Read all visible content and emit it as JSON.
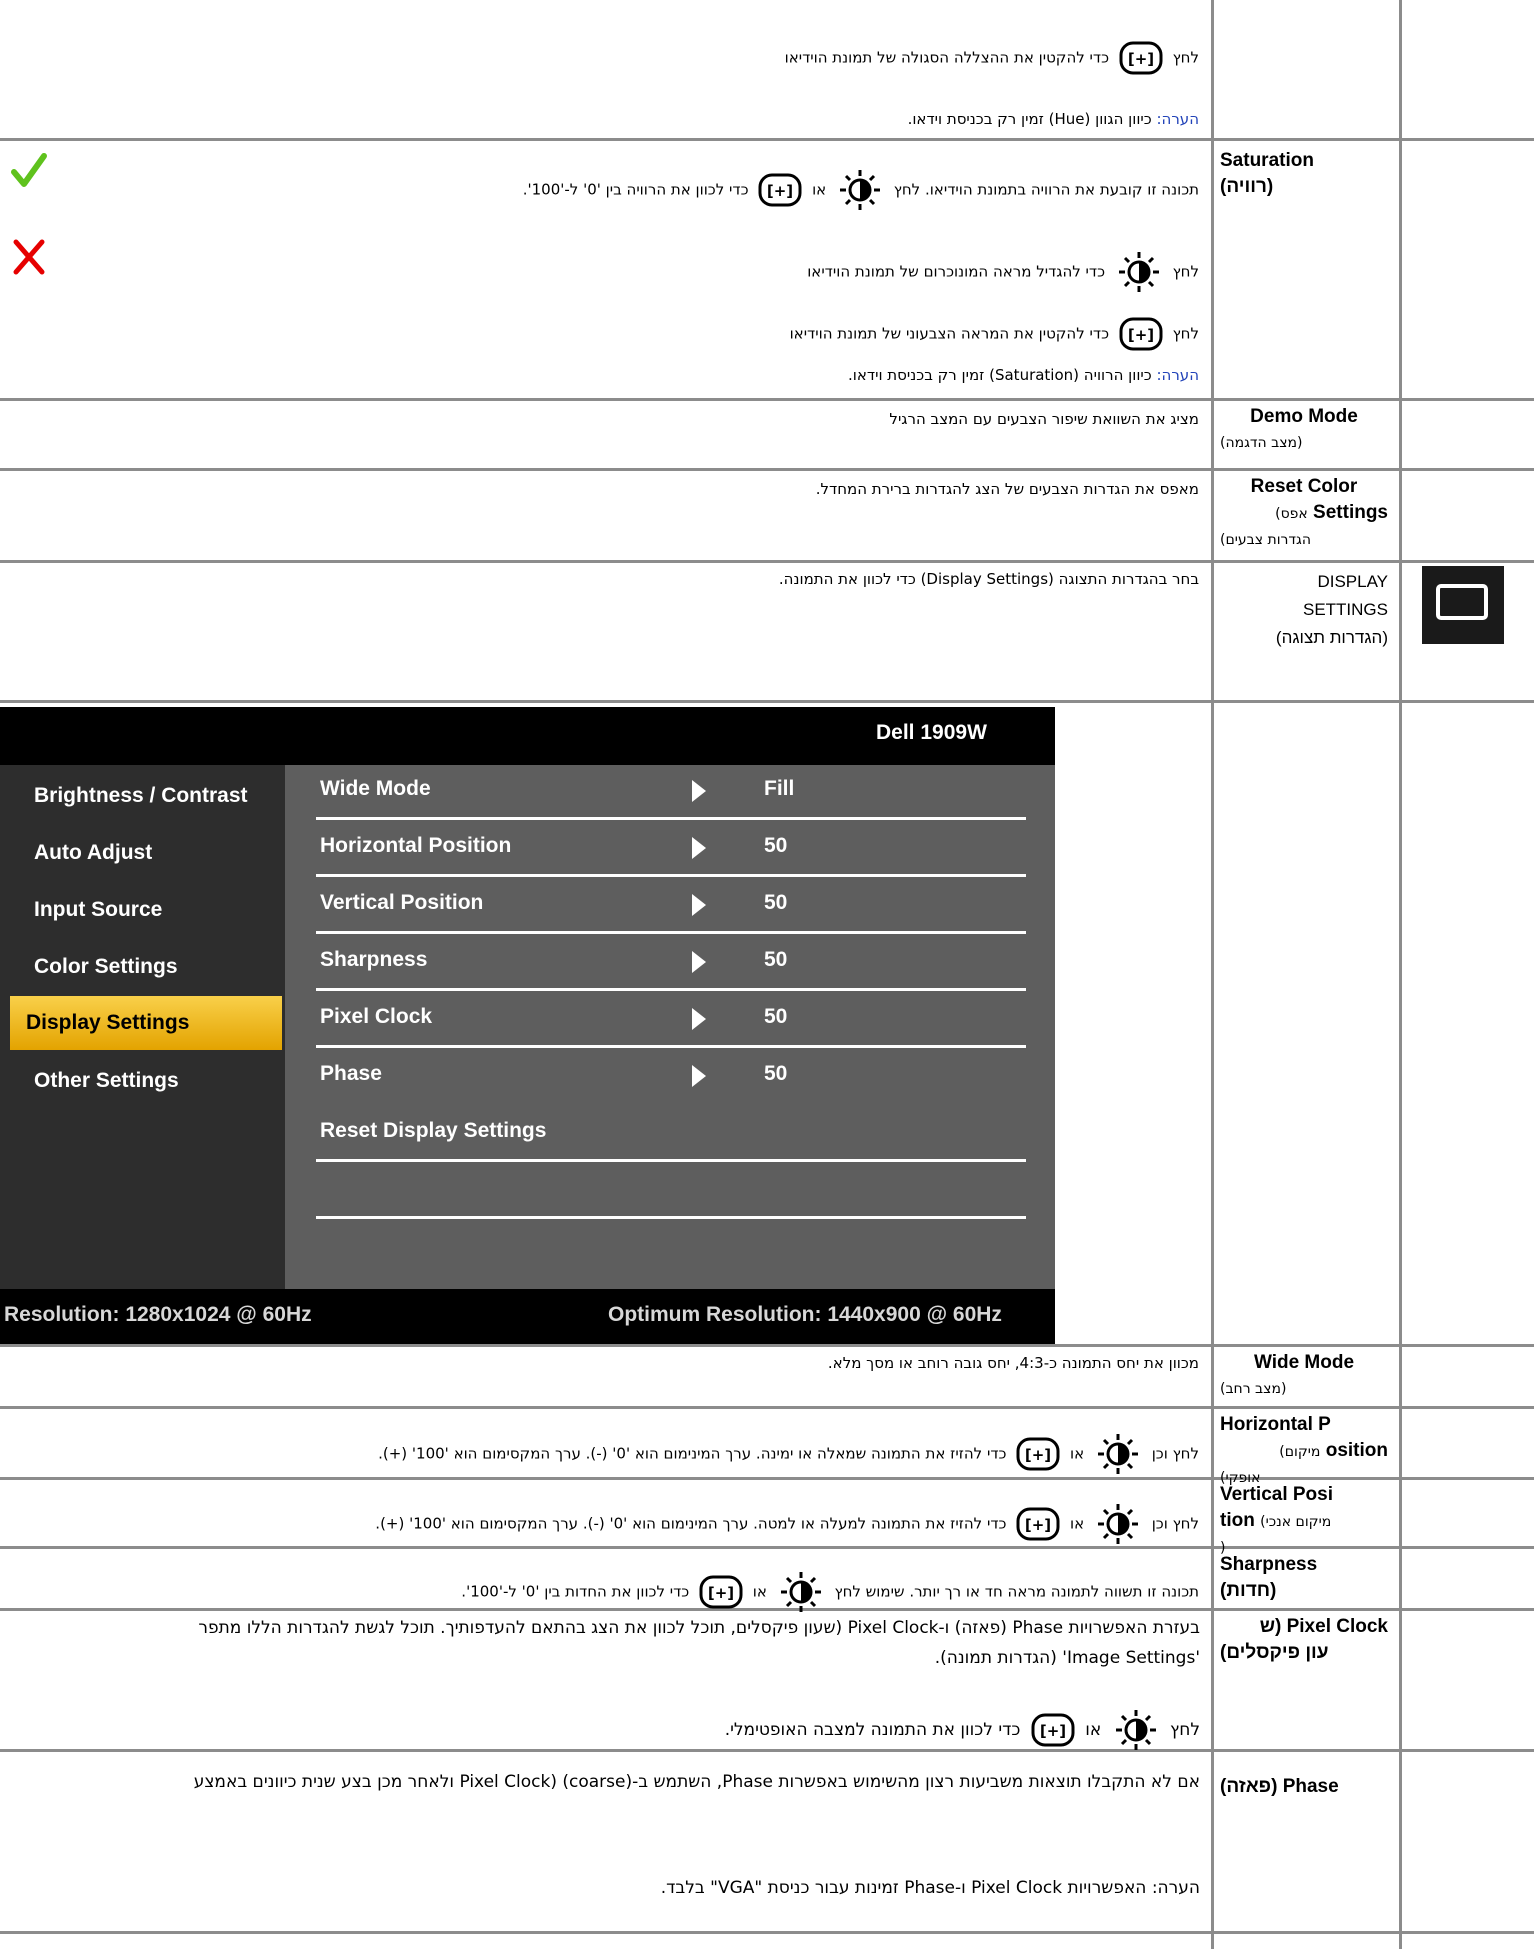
{
  "row_hue": {
    "text1": "לחץ",
    "text2": "כדי להקטין את ההצללה הסגולה של תמונת הוידיאו",
    "note_label": "הערה:",
    "note_text": "כיוון הגוון (Hue) זמין רק בכניסת וידאו."
  },
  "row_saturation": {
    "name": "Saturation",
    "name_sub": "(רוויה)",
    "line1_a": "תכונה זו קובעת את הרוויה בתמונת הוידיאו. לחץ",
    "line1_or": "או",
    "line1_b": "כדי לכוון את הרוויה בין '0' ל-'100'.",
    "line2_a": "לחץ",
    "line2_b": "כדי להגדיל מראה המונוכרום של תמונת הוידיאו",
    "line3_a": "לחץ",
    "line3_b": "כדי להקטין את המראה הצבעוני של תמונת הוידיאו",
    "note_label": "הערה:",
    "note_text": "כיוון הרוויה (Saturation) זמין רק בכניסת וידאו."
  },
  "row_demo": {
    "name": "Demo Mode",
    "name_sub": "(מצב הדגמה)",
    "text": "מציג את השוואת שיפור הצבעים עם המצב הרגיל"
  },
  "row_reset_color": {
    "name1": "Reset Color",
    "name2": "Settings",
    "name_sub1": "(אפס",
    "name_sub2": "הגדרות צבעים)",
    "text": "מאפס את הגדרות הצבעים של הצג להגדרות ברירת המחדל."
  },
  "row_display_settings": {
    "name1": "DISPLAY",
    "name2": "SETTINGS",
    "name3": "(הגדרות תצוגה)",
    "text": "בחר בהגדרות התצוגה (Display Settings) כדי לכוון את התמונה."
  },
  "osd": {
    "model": "Dell 1909W",
    "menu": [
      "Brightness / Contrast",
      "Auto Adjust",
      "Input Source",
      "Color Settings",
      "Display Settings",
      "Other Settings"
    ],
    "rows": [
      {
        "label": "Wide Mode",
        "value": "Fill"
      },
      {
        "label": "Horizontal Position",
        "value": "50"
      },
      {
        "label": "Vertical Position",
        "value": "50"
      },
      {
        "label": "Sharpness",
        "value": "50"
      },
      {
        "label": "Pixel Clock",
        "value": "50"
      },
      {
        "label": "Phase",
        "value": "50"
      },
      {
        "label": "Reset Display Settings",
        "value": ""
      }
    ],
    "resolution": "Resolution: 1280x1024 @ 60Hz",
    "optimum": "Optimum Resolution: 1440x900 @ 60Hz"
  },
  "row_wide": {
    "name": "Wide Mode",
    "name_sub": "(מצב רחב)",
    "text": "מכוון את יחס התמונה כ-4:3, יחס גובה רוחב או מסך מלא."
  },
  "row_hpos": {
    "name1": "Horizontal P",
    "name2": "osition",
    "name_sub1": "(מיקום",
    "name_sub2": "אופקי)",
    "text_a": "לחץ וכן",
    "text_or": "או",
    "text_b": "כדי להזיז את התמונה שמאלה או ימינה. ערך המינימום הוא '0' (-). ערך המקסימום הוא '100' (+)."
  },
  "row_vpos": {
    "name1": "Vertical Posi",
    "name2": "tion",
    "name_sub1": "(מיקום אנכי",
    "name_sub2": ")",
    "text_a": "לחץ וכן",
    "text_or": "או",
    "text_b": "כדי להזיז את התמונה למעלה או למטה. ערך המינימום הוא '0' (-). ערך המקסימום הוא '100' (+)."
  },
  "row_sharp": {
    "name": "Sharpness",
    "name_sub": "(חדות)",
    "text_a": "תכונה זו תשווה לתמונה מראה חד או רך יותר. שימוש לחץ",
    "text_or": "או",
    "text_b": "כדי לכוון את החדות בין '0' ל-'100'."
  },
  "row_pixel": {
    "name1": "Pixel Clock (ש",
    "name2": "עון פיקסלים)",
    "line1": "בעזרת האפשרויות Phase (פאזה) ו-Pixel Clock (שעון פיקסלים, תוכל לכוון את הצג בהתאם להעדפותיך. תוכל לגשת להגדרות הללו מתפר",
    "line2": "'Image Settings' (הגדרות תמונה).",
    "line3_a": "לחץ",
    "line3_or": "או",
    "line3_b": "כדי לכוון את התמונה למצבה האופטימלי."
  },
  "row_phase": {
    "name": "Phase (פאזה)",
    "line1": "אם לא התקבלו תוצאות משביעות רצון מהשימוש באפשרות Phase, השתמש ב-Pixel Clock) (coarse) ולאחר מכן בצע שנית כיוונים באמצע",
    "line2": "הערה: האפשרויות Pixel Clock ו-Phase זמינות עבור כניסת \"VGA\" בלבד."
  }
}
